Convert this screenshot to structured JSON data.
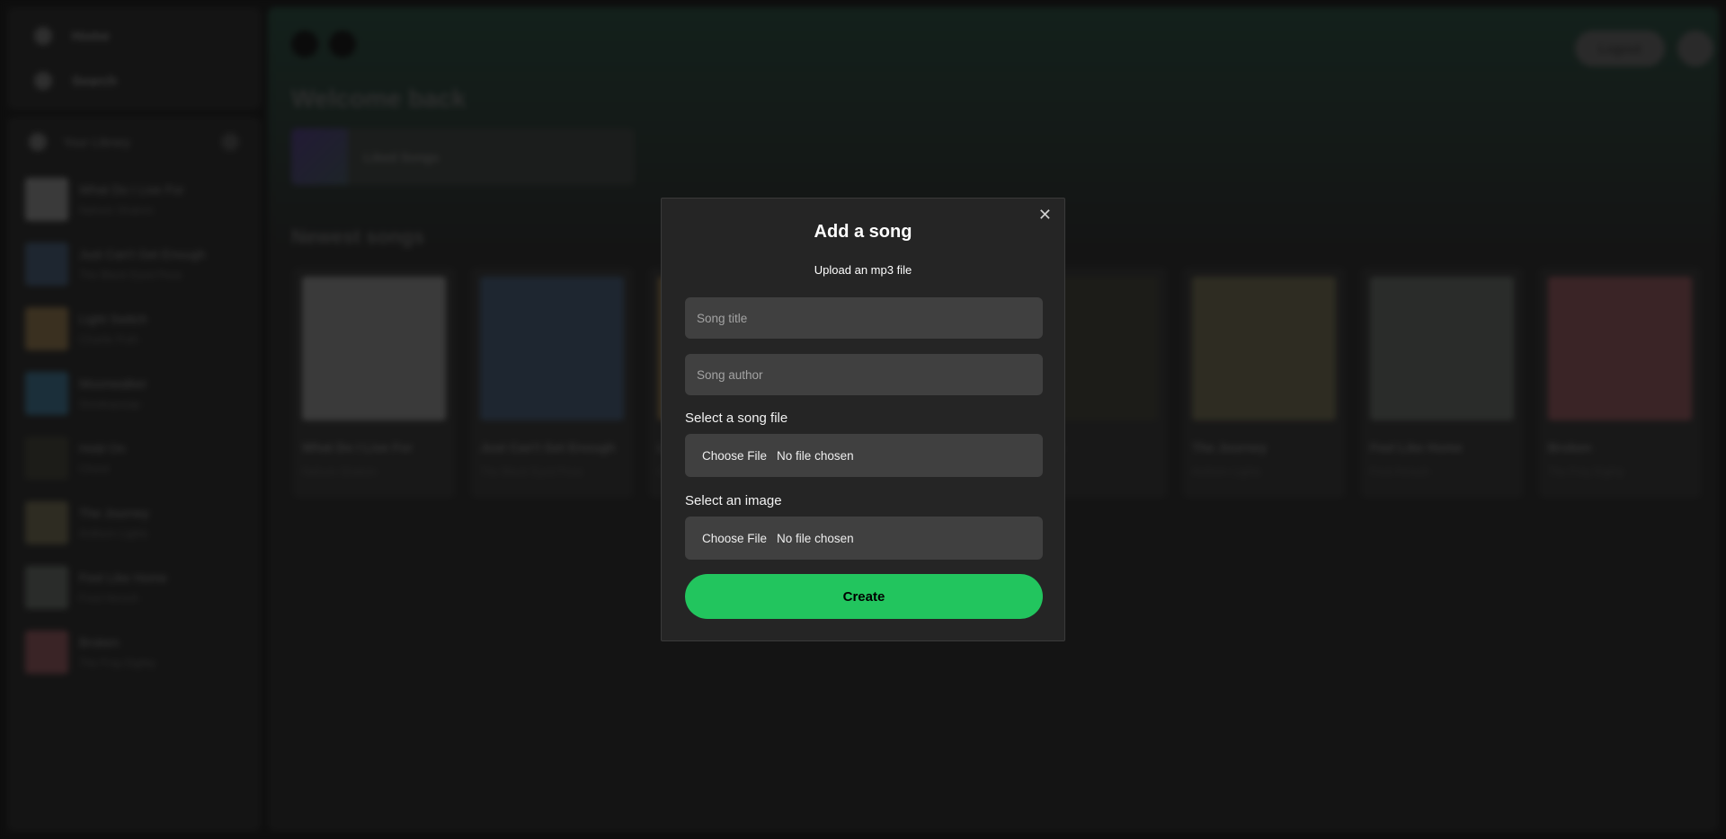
{
  "sidebar": {
    "nav": [
      {
        "label": "Home",
        "icon": "home-icon"
      },
      {
        "label": "Search",
        "icon": "search-icon"
      }
    ],
    "library_label": "Your Library",
    "items": [
      {
        "title": "What Do I Live For",
        "author": "Nahum Shalom",
        "color": "#3a3a3a"
      },
      {
        "title": "Just Can't Get Enough",
        "author": "The Black Eyed Peas",
        "color": "#1e2630"
      },
      {
        "title": "Light Switch",
        "author": "Charlie Puth",
        "color": "#3a3020"
      },
      {
        "title": "Moonwalker",
        "author": "Smokepurpp",
        "color": "#1b2f3a"
      },
      {
        "title": "Hold On",
        "author": "Chord",
        "color": "#1c1c18"
      },
      {
        "title": "The Journey",
        "author": "Anthem Lights",
        "color": "#2e2c22"
      },
      {
        "title": "Feel Like Home",
        "author": "Fred Hersch",
        "color": "#2a2c2a"
      },
      {
        "title": "Broken",
        "author": "The Fray Eighty",
        "color": "#3a2426"
      }
    ]
  },
  "header": {
    "logout_label": "Logout"
  },
  "main": {
    "welcome": "Welcome back",
    "liked_label": "Liked Songs",
    "newest_label": "Newest songs"
  },
  "modal": {
    "title": "Add a song",
    "subtitle": "Upload an mp3 file",
    "title_placeholder": "Song title",
    "author_placeholder": "Song author",
    "song_file_label": "Select a song file",
    "image_label": "Select an image",
    "choose_file": "Choose File",
    "no_file": "No file chosen",
    "create_label": "Create",
    "close_icon": "close-icon"
  },
  "colors": {
    "accent": "#22c55e",
    "modal_bg": "#252525",
    "input_bg": "#404040"
  }
}
